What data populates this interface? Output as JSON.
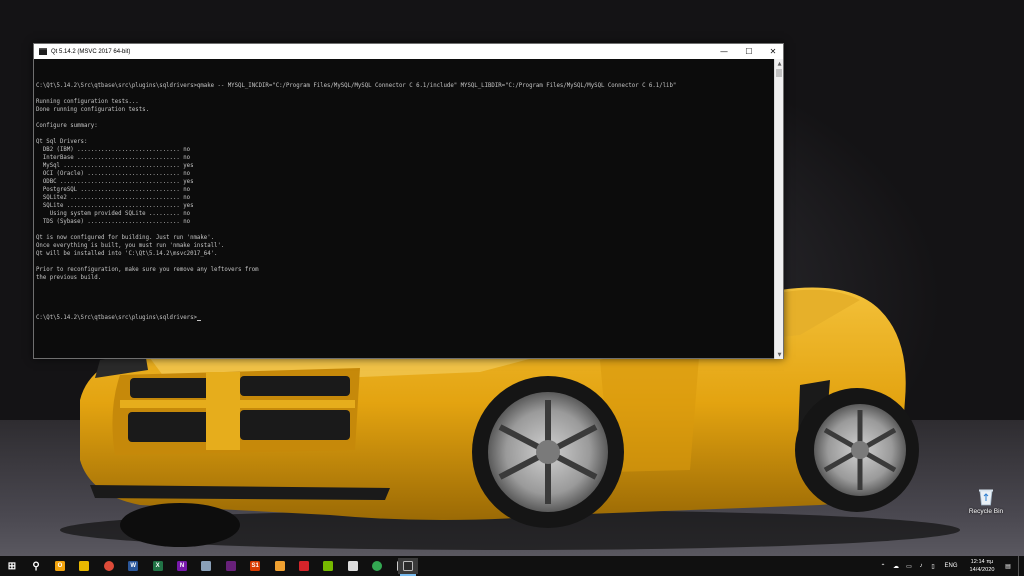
{
  "window": {
    "title": "Qt 5.14.2 (MSVC 2017 64-bit)",
    "controls": {
      "minimize": "—",
      "maximize": "☐",
      "close": "✕"
    }
  },
  "console": {
    "lines": [
      "C:\\Qt\\5.14.2\\Src\\qtbase\\src\\plugins\\sqldrivers>qmake -- MYSQL_INCDIR=\"C:/Program Files/MySQL/MySQL Connector C 6.1/include\" MYSQL_LIBDIR=\"C:/Program Files/MySQL/MySQL Connector C 6.1/lib\"",
      "",
      "Running configuration tests...",
      "Done running configuration tests.",
      "",
      "Configure summary:",
      "",
      "Qt Sql Drivers:",
      "  DB2 (IBM) .............................. no",
      "  InterBase .............................. no",
      "  MySql .................................. yes",
      "  OCI (Oracle) ........................... no",
      "  ODBC ................................... yes",
      "  PostgreSQL ............................. no",
      "  SQLite2 ................................ no",
      "  SQLite ................................. yes",
      "    Using system provided SQLite ......... no",
      "  TDS (Sybase) ........................... no",
      "",
      "Qt is now configured for building. Just run 'nmake'.",
      "Once everything is built, you must run 'nmake install'.",
      "Qt will be installed into 'C:\\Qt\\5.14.2\\msvc2017_64'.",
      "",
      "Prior to reconfiguration, make sure you remove any leftovers from",
      "the previous build.",
      "",
      ""
    ],
    "prompt": "C:\\Qt\\5.14.2\\Src\\qtbase\\src\\plugins\\sqldrivers>"
  },
  "desktop": {
    "recycle_bin_label": "Recycle Bin"
  },
  "taskbar": {
    "pinned": [
      {
        "name": "start-button-icon",
        "glyph": "⊞",
        "color": "#ffffff"
      },
      {
        "name": "search-icon",
        "glyph": "⚲",
        "color": "#ffffff"
      },
      {
        "name": "outlook-icon",
        "glyph": "O",
        "color": "#f1a30d"
      },
      {
        "name": "chrome-like-icon",
        "glyph": "",
        "color": "#e8b800"
      },
      {
        "name": "chrome-icon",
        "glyph": "",
        "color": "#dd4b39"
      },
      {
        "name": "word-icon",
        "glyph": "W",
        "color": "#2b579a"
      },
      {
        "name": "excel-icon",
        "glyph": "X",
        "color": "#217346"
      },
      {
        "name": "onenote-icon",
        "glyph": "N",
        "color": "#7719aa"
      },
      {
        "name": "vpn-icon",
        "glyph": "",
        "color": "#8aa0b8"
      },
      {
        "name": "visual-studio-icon",
        "glyph": "",
        "color": "#68217a"
      },
      {
        "name": "s1-app-icon",
        "glyph": "S1",
        "color": "#d83b01"
      },
      {
        "name": "pdf-icon",
        "glyph": "",
        "color": "#f0a030"
      },
      {
        "name": "acrobat-icon",
        "glyph": "",
        "color": "#d4242a"
      },
      {
        "name": "nvidia-icon",
        "glyph": "",
        "color": "#76b900"
      },
      {
        "name": "inkscape-icon",
        "glyph": "",
        "color": "#dddddd"
      },
      {
        "name": "teams-like-icon",
        "glyph": "",
        "color": "#33a852"
      },
      {
        "name": "rocket-icon",
        "glyph": "",
        "color": "#cccccc"
      },
      {
        "name": "terminal-icon",
        "glyph": "",
        "color": "#2b2b2b"
      }
    ],
    "tray": {
      "language": "ENG",
      "time": "12:14 πμ",
      "date": "14/4/2020"
    }
  },
  "colors": {
    "console_bg": "#0c0c0c",
    "console_text": "#c5c5c5",
    "car_yellow": "#e3a310",
    "taskbar_bg": "#101010"
  }
}
